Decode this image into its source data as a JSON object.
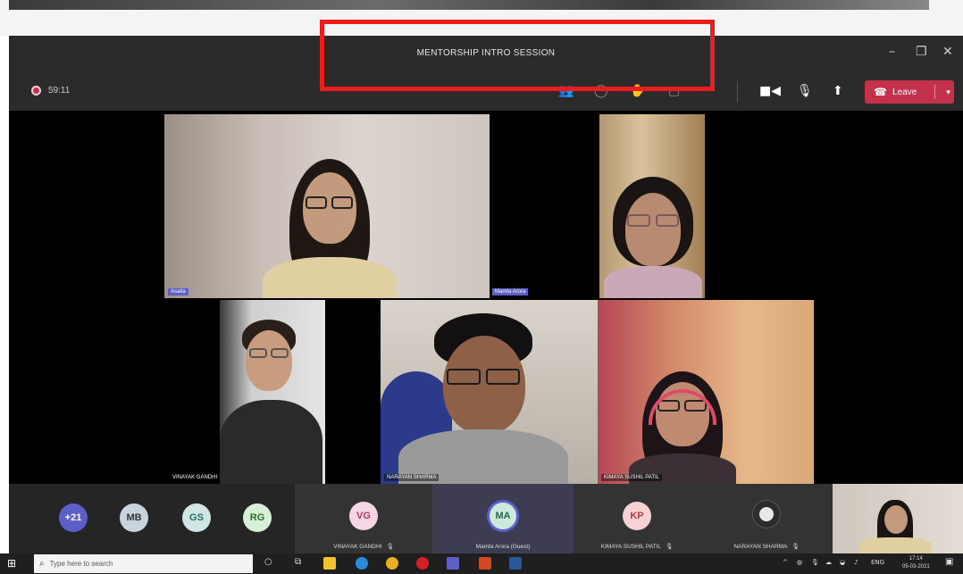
{
  "meeting": {
    "title": "MENTORSHIP INTRO SESSION",
    "elapsed": "59:11",
    "leave_label": "Leave",
    "window_controls": [
      "minimize-icon",
      "maximize-icon",
      "close-icon"
    ]
  },
  "toolbar_icons": [
    "participants-icon",
    "chat-icon",
    "raise-hand-icon",
    "rooms-icon",
    "camera-icon",
    "microphone-icon",
    "share-screen-icon"
  ],
  "video_tiles": [
    {
      "name": "Asaita"
    },
    {
      "name": "Mamta Arora"
    },
    {
      "name": "VINAYAK GANDHI"
    },
    {
      "name": "NARAYAN SHARMA"
    },
    {
      "name": "KIMAYA SUSHIL PATIL"
    }
  ],
  "roster": {
    "overflow_count": "+21",
    "initial_avatars": [
      {
        "initials": "MB",
        "color": "#c9d3e0"
      },
      {
        "initials": "GS",
        "color": "#cfe6e4"
      },
      {
        "initials": "RG",
        "color": "#d7efd7"
      }
    ],
    "cards": [
      {
        "initials": "VG",
        "name": "VINAYAK GANDHI",
        "color": "#f6d6e2"
      },
      {
        "initials": "MA",
        "name": "Mamta Arora (Guest)",
        "color": "#cde9dd"
      },
      {
        "initials": "KP",
        "name": "KIMAYA SUSHIL PATIL",
        "color": "#f7d2d2"
      },
      {
        "initials": "",
        "name": "NARAYAN SHARMA",
        "color": "#2c2c2c"
      }
    ]
  },
  "taskbar": {
    "search_placeholder": "Type here to search",
    "language": "ENG",
    "time": "17:14",
    "date": "05-03-2021"
  },
  "colors": {
    "leave": "#c4314b",
    "speaking_ring": "#5b5fc7",
    "highlight": "#ee1c1c"
  }
}
